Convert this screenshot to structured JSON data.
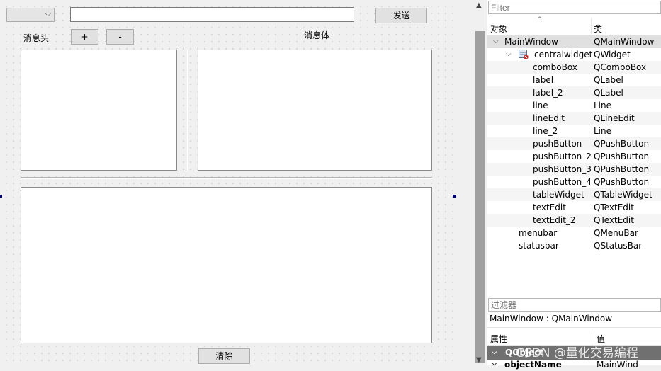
{
  "form": {
    "send_button": "发送",
    "add_button": "+",
    "remove_button": "-",
    "header_label": "消息头",
    "body_label": "消息体",
    "clear_button": "清除",
    "line_edit_value": ""
  },
  "object_inspector": {
    "filter_placeholder": "Filter",
    "col_object": "对象",
    "col_class": "类",
    "rows": [
      {
        "name": "MainWindow",
        "cls": "QMainWindow"
      },
      {
        "name": "centralwidget",
        "cls": "QWidget"
      },
      {
        "name": "comboBox",
        "cls": "QComboBox"
      },
      {
        "name": "label",
        "cls": "QLabel"
      },
      {
        "name": "label_2",
        "cls": "QLabel"
      },
      {
        "name": "line",
        "cls": "Line"
      },
      {
        "name": "lineEdit",
        "cls": "QLineEdit"
      },
      {
        "name": "line_2",
        "cls": "Line"
      },
      {
        "name": "pushButton",
        "cls": "QPushButton"
      },
      {
        "name": "pushButton_2",
        "cls": "QPushButton"
      },
      {
        "name": "pushButton_3",
        "cls": "QPushButton"
      },
      {
        "name": "pushButton_4",
        "cls": "QPushButton"
      },
      {
        "name": "tableWidget",
        "cls": "QTableWidget"
      },
      {
        "name": "textEdit",
        "cls": "QTextEdit"
      },
      {
        "name": "textEdit_2",
        "cls": "QTextEdit"
      },
      {
        "name": "menubar",
        "cls": "QMenuBar"
      },
      {
        "name": "statusbar",
        "cls": "QStatusBar"
      }
    ]
  },
  "property_editor": {
    "filter_placeholder": "过滤器",
    "title": "MainWindow : QMainWindow",
    "col_property": "属性",
    "col_value": "值",
    "group": "QObject",
    "first_row_name": "objectName",
    "first_row_value": "MainWind"
  },
  "watermark": "CSDN @量化交易编程",
  "icons": {
    "expand": "chevron-down-icon",
    "widget": "widget-icon",
    "scroll_up": "scroll-up-icon",
    "scroll_down": "scroll-down-icon"
  }
}
